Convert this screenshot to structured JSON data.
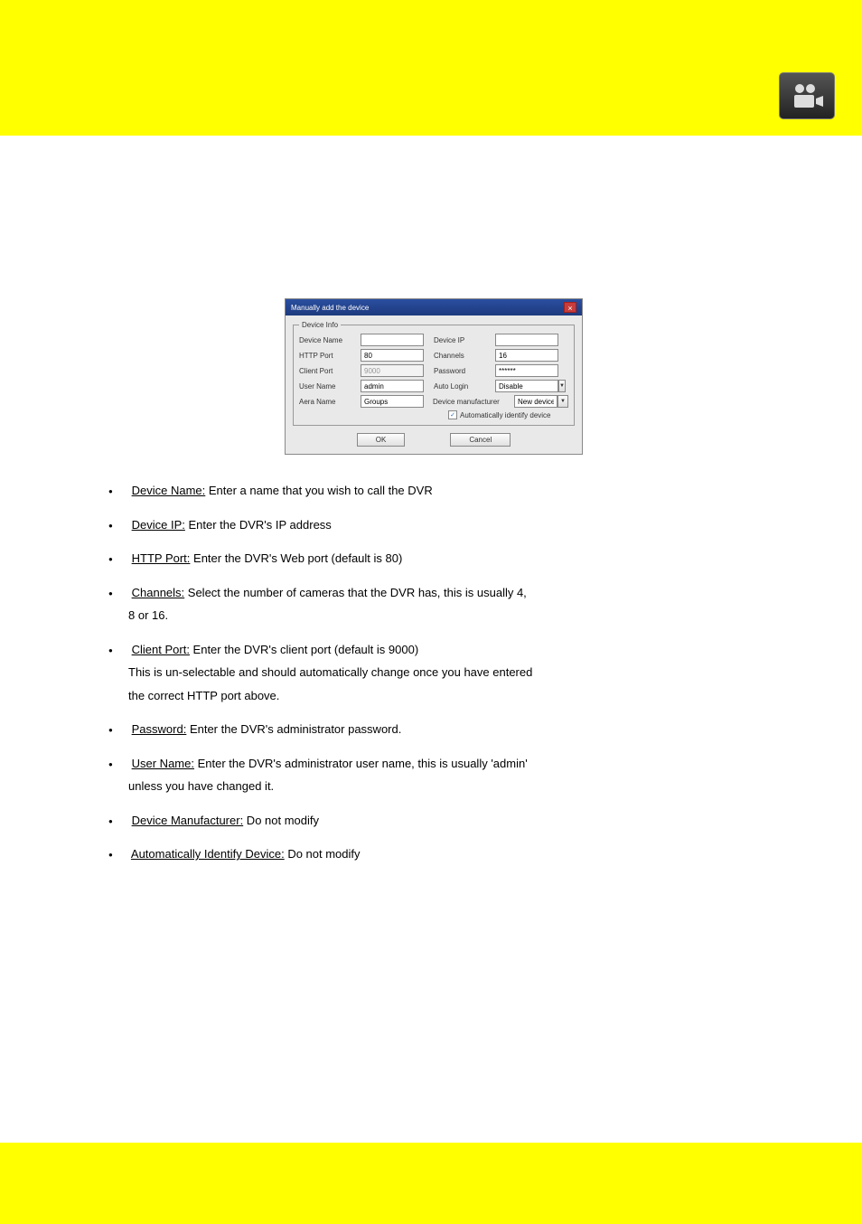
{
  "dialog": {
    "title": "Manually add the device",
    "legend": "Device Info",
    "fields": {
      "deviceName": {
        "label": "Device Name",
        "value": ""
      },
      "deviceIp": {
        "label": "Device IP",
        "value": ""
      },
      "httpPort": {
        "label": "HTTP Port",
        "value": "80"
      },
      "channels": {
        "label": "Channels",
        "value": "16"
      },
      "clientPort": {
        "label": "Client Port",
        "value": "9000"
      },
      "password": {
        "label": "Password",
        "value": "******"
      },
      "userName": {
        "label": "User Name",
        "value": "admin"
      },
      "autoLogin": {
        "label": "Auto Login",
        "value": "Disable"
      },
      "areaName": {
        "label": "Aera Name",
        "value": "Groups"
      },
      "deviceMfr": {
        "label": "Device manufacturer",
        "value": "New device"
      }
    },
    "autoIdentify": {
      "label": "Automatically identify device",
      "checked": true
    },
    "ok": "OK",
    "cancel": "Cancel"
  },
  "bullets": {
    "b1": {
      "term": "Device Name:",
      "rest": " Enter a name that you wish to call the DVR"
    },
    "b2": {
      "term": "Device IP:",
      "rest": " Enter the DVR's IP address"
    },
    "b3": {
      "term": "HTTP Port:",
      "rest": " Enter the DVR's Web port (default is 80)"
    },
    "b4": {
      "term": "Channels:",
      "rest": " Select the number of cameras that the DVR has, this is usually 4,",
      "line2": "8 or 16."
    },
    "b5": {
      "term": "Client Port:",
      "rest": " Enter the DVR's client port (default is 9000)",
      "sub": "This is un-selectable and should automatically change once you have entered",
      "sub2": "the correct HTTP port above."
    },
    "b6": {
      "term": "Password:",
      "rest": " Enter the DVR's administrator password."
    },
    "b7": {
      "term": "User Name:",
      "rest": " Enter the DVR's administrator user name, this is usually 'admin'",
      "line2": "unless you have changed it."
    },
    "b8": {
      "term": "Device Manufacturer:",
      "rest": " Do not modify"
    },
    "b9": {
      "term": "Automatically Identify Device:",
      "rest": " Do not modify"
    }
  }
}
